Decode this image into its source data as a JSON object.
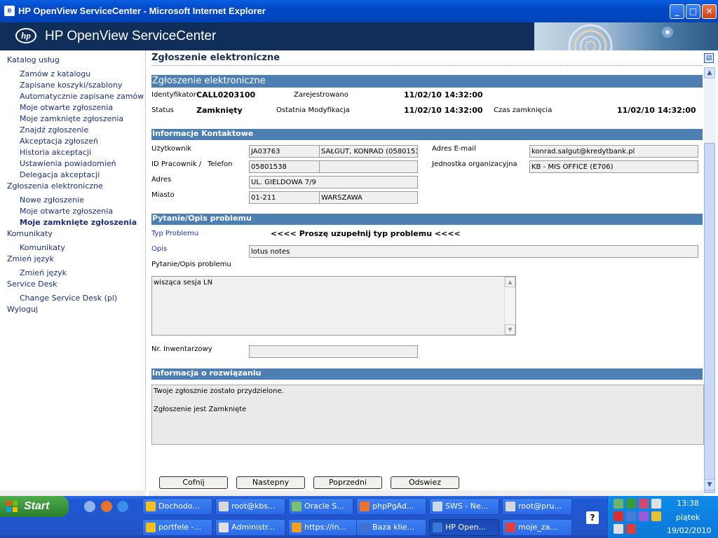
{
  "window": {
    "title": "HP OpenView ServiceCenter - Microsoft Internet Explorer",
    "minimize_glyph": "_",
    "maximize_glyph": "□",
    "close_glyph": "✕"
  },
  "header": {
    "logo_text": "hp",
    "app_title": "HP OpenView ServiceCenter"
  },
  "leftnav": {
    "items": [
      {
        "label": "Katalog usług",
        "level": "top"
      },
      {
        "label": "Zamów z katalogu",
        "level": "sub"
      },
      {
        "label": "Zapisane koszyki/szablony",
        "level": "sub"
      },
      {
        "label": "Automatycznie zapisane zamów",
        "level": "sub"
      },
      {
        "label": "Moje otwarte zgłoszenia",
        "level": "sub"
      },
      {
        "label": "Moje zamknięte zgłoszenia",
        "level": "sub"
      },
      {
        "label": "Znajdź zgłoszenie",
        "level": "sub"
      },
      {
        "label": "Akceptacja zgłoszeń",
        "level": "sub"
      },
      {
        "label": "Historia akceptacji",
        "level": "sub"
      },
      {
        "label": "Ustawienia powiadomień",
        "level": "sub"
      },
      {
        "label": "Delegacja akceptacji",
        "level": "sub"
      },
      {
        "label": "Zgłoszenia elektroniczne",
        "level": "top"
      },
      {
        "label": "Nowe zgłoszenie",
        "level": "sub"
      },
      {
        "label": "Moje otwarte zgłoszenia",
        "level": "sub"
      },
      {
        "label": "Moje zamknięte zgłoszenia",
        "level": "sub",
        "active": true
      },
      {
        "label": "Komunikaty",
        "level": "top"
      },
      {
        "label": "Komunikaty",
        "level": "sub"
      },
      {
        "label": "Zmień język",
        "level": "top"
      },
      {
        "label": "Zmień język",
        "level": "sub"
      },
      {
        "label": "Service Desk",
        "level": "top"
      },
      {
        "label": "Change Service Desk (pl)",
        "level": "sub"
      },
      {
        "label": "Wyloguj",
        "level": "top"
      }
    ]
  },
  "main": {
    "page_title": "Zgłoszenie elektroniczne",
    "section_title": "Zgłoszenie elektroniczne",
    "summary": {
      "id_label": "Identyfikator",
      "id_value": "CALL0203100",
      "registered_label": "Zarejestrowano",
      "registered_value": "11/02/10 14:32:00",
      "status_label": "Status",
      "status_value": "Zamknięty",
      "modified_label": "Ostatnia Modyfikacja",
      "modified_value": "11/02/10 14:32:00",
      "closed_label": "Czas zamknięcia",
      "closed_value": "11/02/10 14:32:00"
    },
    "contact": {
      "title": "Informacje Kontaktowe",
      "user_label": "Użytkownik",
      "user_id": "JA03763",
      "user_name": "SAŁGUT, KONRAD (0580153",
      "email_label": "Adres E-mail",
      "email_value": "konrad.salgut@kredytbank.pl",
      "empid_label": "ID Pracownik /",
      "phone_label": "Telefon",
      "empid_value": "05801538",
      "phone_value": "",
      "unit_label": "Jednostka organizacyjna",
      "unit_value": "KB - MIS OFFICE (E706)",
      "address_label": "Adres",
      "address_value": "UL. GIELDOWA 7/9",
      "city_label": "Miasto",
      "zip_value": "01-211",
      "city_value": "WARSZAWA"
    },
    "problem": {
      "title": "Pytanie/Opis problemu",
      "type_label": "Typ Problemu",
      "type_value": "<<<< Proszę uzupełnij typ problemu <<<<",
      "desc_label": "Opis",
      "desc_value": "lotus notes",
      "question_label": "Pytanie/Opis problemu",
      "question_value": "wisząca sesja LN",
      "inventory_label": "Nr. Inwentarzowy",
      "inventory_value": ""
    },
    "resolution": {
      "title": "Informacja o rozwiązaniu",
      "line1": "Twoje zgłosznie zostało przydzielone.",
      "line2": "Zgłoszenie jest Zamknięte"
    },
    "buttons": {
      "back": "Cofnij",
      "next": "Nastepny",
      "prev": "Poprzedni",
      "refresh": "Odswiez"
    }
  },
  "taskbar": {
    "start_label": "Start",
    "tasks_row1": [
      {
        "label": "Dochodo...",
        "icon_color": "#f0c020"
      },
      {
        "label": "root@kbs...",
        "icon_color": "#d8d8d8"
      },
      {
        "label": "Oracle S...",
        "icon_color": "#7ac070"
      },
      {
        "label": "phpPgAd...",
        "icon_color": "#e8742c"
      },
      {
        "label": "SWS - Ne...",
        "icon_color": "#c8d8f0"
      },
      {
        "label": "root@pru...",
        "icon_color": "#d8d8d8"
      }
    ],
    "tasks_row2": [
      {
        "label": "portfele -...",
        "icon_color": "#f0c020"
      },
      {
        "label": "Administr...",
        "icon_color": "#e0e0e0"
      },
      {
        "label": "https://in...",
        "icon_color": "#f0a020"
      },
      {
        "label": "Baza klie...",
        "icon_color": "#4070d0"
      },
      {
        "label": "HP Open...",
        "icon_color": "#3a78d8",
        "active": true
      },
      {
        "label": "moje_za...",
        "icon_color": "#e04040"
      }
    ],
    "help_label": "?",
    "clock_time": "13:38",
    "clock_day": "piątek",
    "clock_date": "19/02/2010"
  }
}
